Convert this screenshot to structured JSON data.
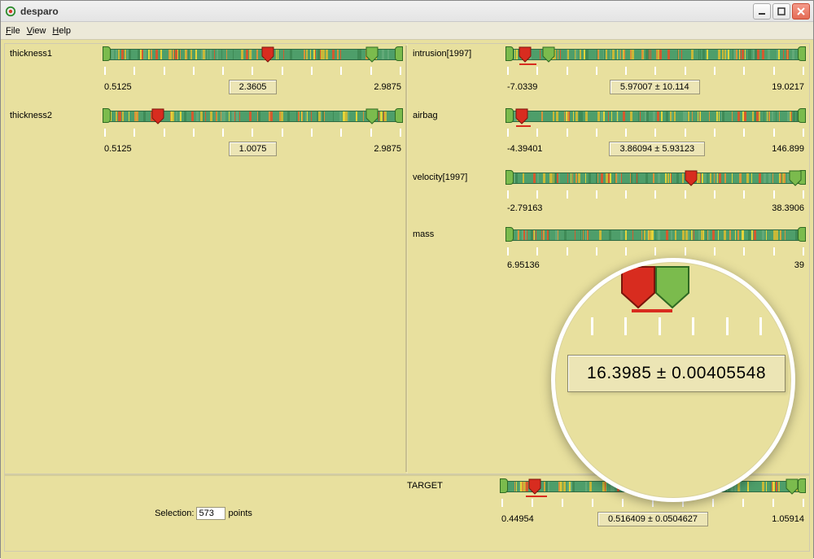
{
  "window": {
    "title": "desparo"
  },
  "menu": {
    "file": "File",
    "view": "View",
    "help": "Help"
  },
  "left": {
    "items": [
      {
        "label": "thickness1",
        "min": "0.5125",
        "center": "2.3605",
        "max": "2.9875",
        "red_pct": 55,
        "green_pct": 90
      },
      {
        "label": "thickness2",
        "min": "0.5125",
        "center": "1.0075",
        "max": "2.9875",
        "red_pct": 18,
        "green_pct": 90
      }
    ]
  },
  "right": {
    "items": [
      {
        "label": "intrusion[1997]",
        "min": "-7.0339",
        "center": "5.97007 ± 10.114",
        "max": "19.0217",
        "red_pct": 6,
        "green_pct": 14,
        "redline_l": 4,
        "redline_w": 6
      },
      {
        "label": "airbag",
        "min": "-4.39401",
        "center": "3.86094 ± 5.93123",
        "max": "146.899",
        "red_pct": 5,
        "green_pct": 2,
        "redline_l": 3,
        "redline_w": 5
      },
      {
        "label": "velocity[1997]",
        "min": "-2.79163",
        "center": "",
        "max": "38.3906",
        "red_pct": 62,
        "green_pct": 97
      },
      {
        "label": "mass",
        "min": "6.95136",
        "center": "",
        "max": "39",
        "red_pct": 40,
        "green_pct": 50
      }
    ]
  },
  "magnifier": {
    "value": "16.3985 ± 0.00405548"
  },
  "bottom": {
    "selection_label": "Selection:",
    "selection_value": "573",
    "selection_unit": "points",
    "target": {
      "label": "TARGET",
      "min": "0.44954",
      "center": "0.516409 ± 0.0504627",
      "max": "1.05914",
      "red_pct": 11,
      "green_pct": 96
    }
  }
}
